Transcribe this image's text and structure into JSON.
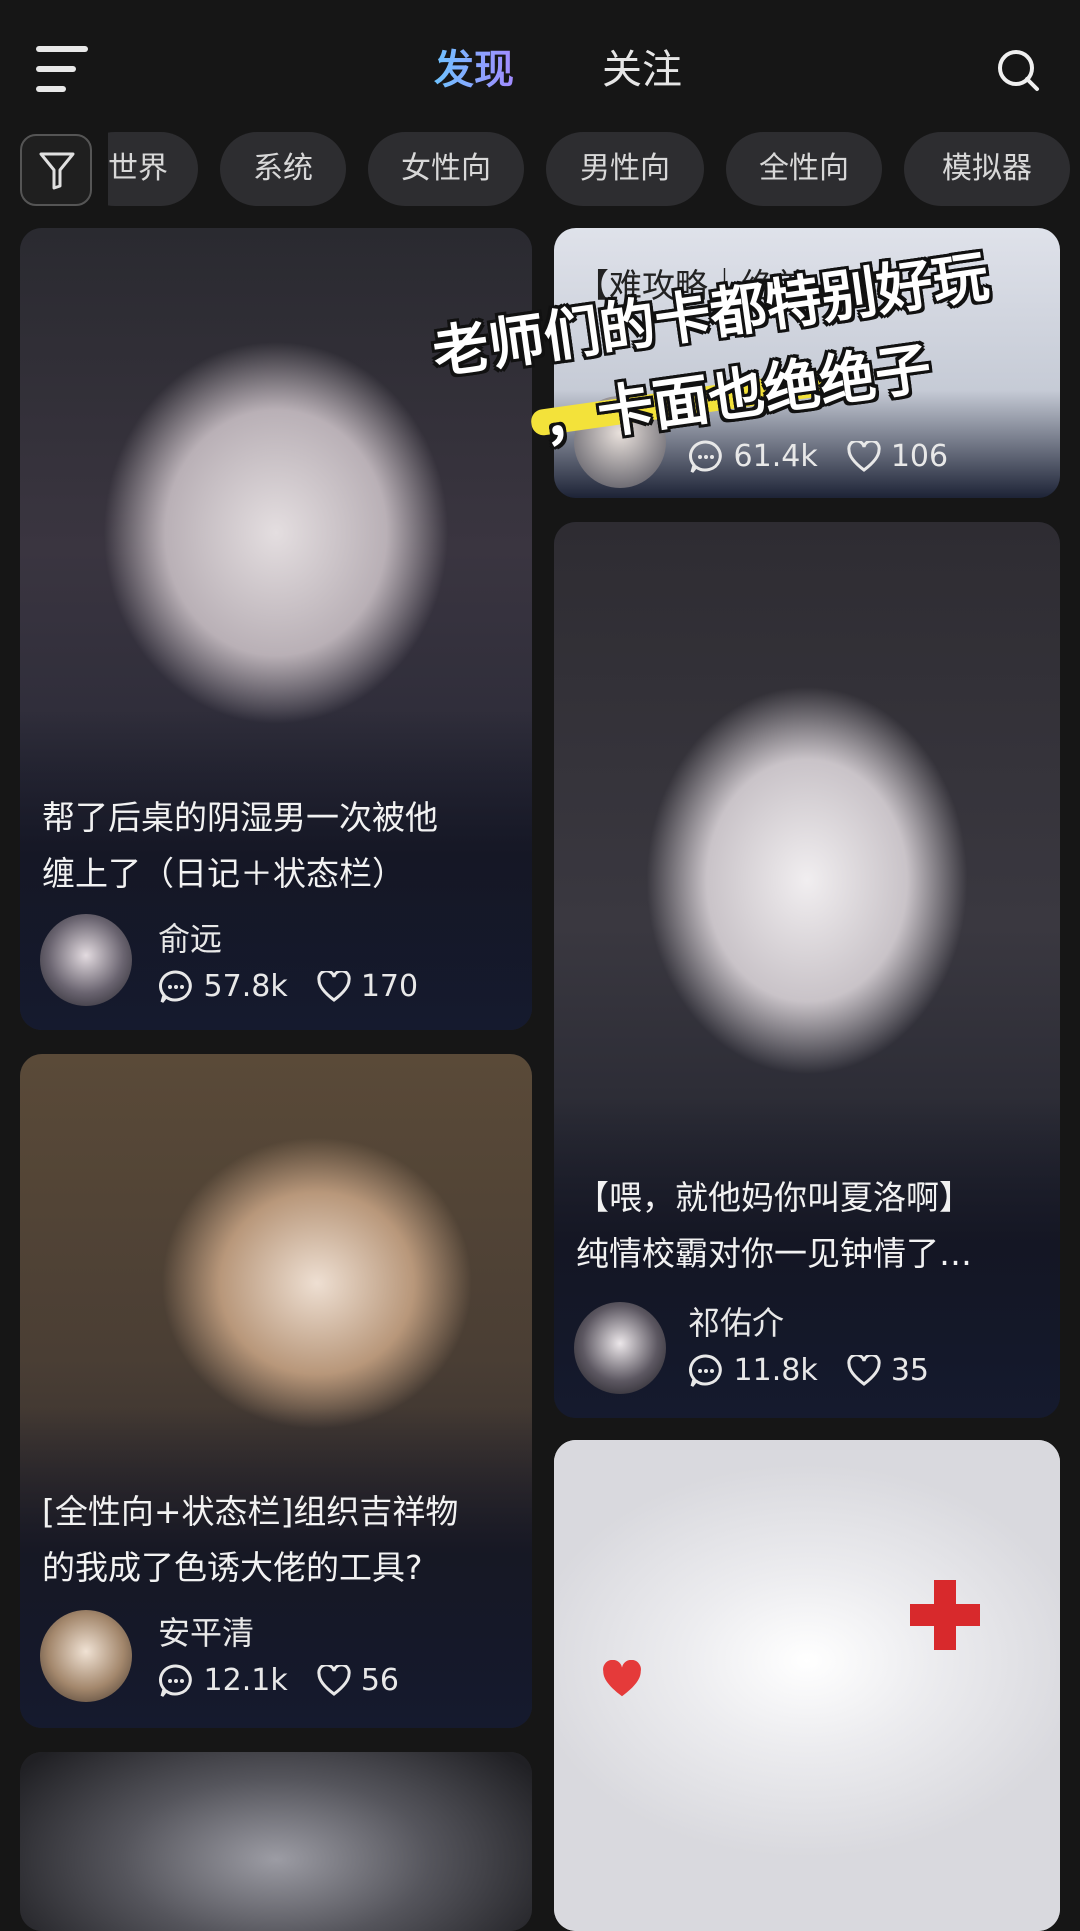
{
  "header": {
    "tab_discover": "发现",
    "tab_follow": "关注",
    "accent_gradient": [
      "#6ec3ff",
      "#a28bff"
    ]
  },
  "categories": [
    "世界",
    "系统",
    "女性向",
    "男性向",
    "全性向",
    "模拟器"
  ],
  "cards": [
    {
      "title_lines": [
        "【难攻略｜绝美"
      ],
      "author": "",
      "comments": "61.4k",
      "likes": "106"
    },
    {
      "title_lines": [
        "帮了后桌的阴湿男一次被他",
        "缠上了（日记＋状态栏）"
      ],
      "author": "俞远",
      "comments": "57.8k",
      "likes": "170"
    },
    {
      "title_lines": [
        "【喂，就他妈你叫夏洛啊】",
        "纯情校霸对你一见钟情了…"
      ],
      "author": "祁佑介",
      "comments": "11.8k",
      "likes": "35"
    },
    {
      "title_lines": [
        "[全性向+状态栏]组织吉祥物",
        "的我成了色诱大佬的工具?"
      ],
      "author": "安平清",
      "comments": "12.1k",
      "likes": "56"
    }
  ],
  "overlay_caption": {
    "line1": "老师们的卡都特别好玩",
    "line2": "，卡面也绝绝子",
    "highlight_color": "#f3e23a"
  },
  "icons": [
    "menu-icon",
    "search-icon",
    "filter-icon",
    "comment-icon",
    "heart-icon"
  ]
}
